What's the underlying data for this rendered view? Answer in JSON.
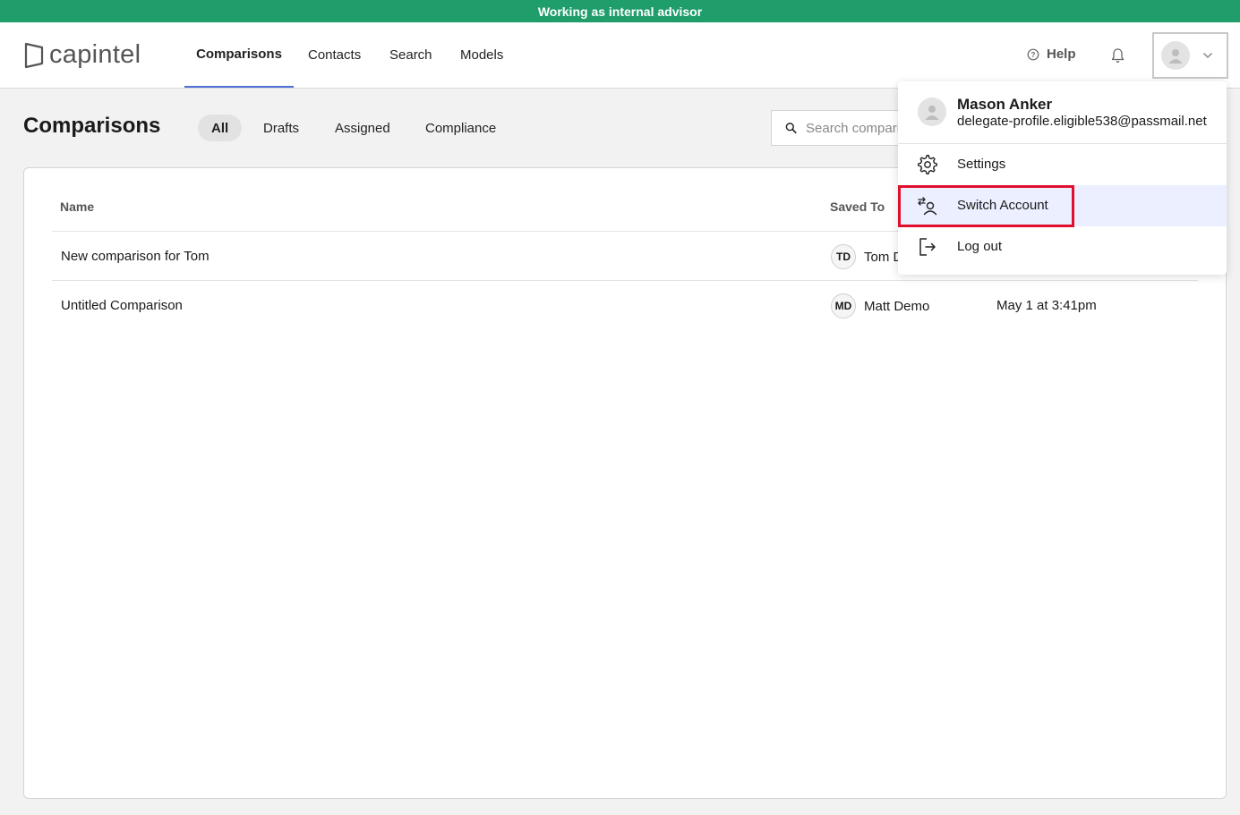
{
  "banner": {
    "text": "Working as internal advisor"
  },
  "brand": {
    "name": "capintel"
  },
  "nav": {
    "tabs": [
      {
        "label": "Comparisons",
        "active": true
      },
      {
        "label": "Contacts"
      },
      {
        "label": "Search"
      },
      {
        "label": "Models"
      }
    ],
    "help_label": "Help"
  },
  "page": {
    "title": "Comparisons",
    "filters": [
      {
        "label": "All",
        "active": true
      },
      {
        "label": "Drafts"
      },
      {
        "label": "Assigned"
      },
      {
        "label": "Compliance"
      }
    ],
    "search_placeholder": "Search comparisons"
  },
  "table": {
    "columns": [
      "Name",
      "Saved To"
    ],
    "rows": [
      {
        "name": "New comparison for Tom",
        "initials": "TD",
        "owner": "Tom D",
        "date": ""
      },
      {
        "name": "Untitled Comparison",
        "initials": "MD",
        "owner": "Matt Demo",
        "date": "May 1 at 3:41pm"
      }
    ]
  },
  "user_menu": {
    "name": "Mason Anker",
    "email": "delegate-profile.eligible538@passmail.net",
    "items": [
      {
        "label": "Settings",
        "icon": "gear-icon"
      },
      {
        "label": "Switch Account",
        "icon": "switch-account-icon",
        "highlighted": true
      },
      {
        "label": "Log out",
        "icon": "logout-icon"
      }
    ]
  },
  "colors": {
    "banner": "#1f9d6a",
    "active_tab_underline": "#4f6fd9",
    "menu_hover": "#ebefff",
    "highlight": "#e0102d"
  }
}
